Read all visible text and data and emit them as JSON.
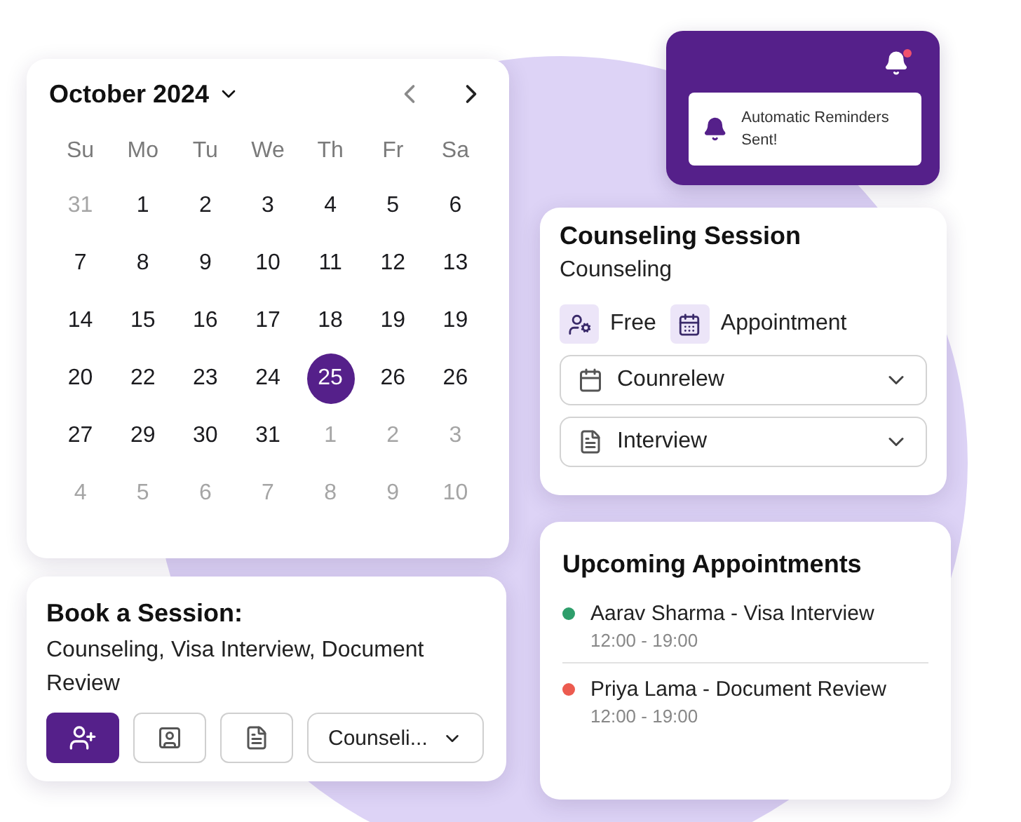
{
  "calendar": {
    "month": "October 2024",
    "weekdays": [
      "Su",
      "Mo",
      "Tu",
      "We",
      "Th",
      "Fr",
      "Sa"
    ],
    "weeks": [
      [
        {
          "day": "31",
          "outside": true,
          "selected": false
        },
        {
          "day": "1",
          "outside": false,
          "selected": false
        },
        {
          "day": "2",
          "outside": false,
          "selected": false
        },
        {
          "day": "3",
          "outside": false,
          "selected": false
        },
        {
          "day": "4",
          "outside": false,
          "selected": false
        },
        {
          "day": "5",
          "outside": false,
          "selected": false
        },
        {
          "day": "6",
          "outside": false,
          "selected": false
        }
      ],
      [
        {
          "day": "7",
          "outside": false,
          "selected": false
        },
        {
          "day": "8",
          "outside": false,
          "selected": false
        },
        {
          "day": "9",
          "outside": false,
          "selected": false
        },
        {
          "day": "10",
          "outside": false,
          "selected": false
        },
        {
          "day": "11",
          "outside": false,
          "selected": false
        },
        {
          "day": "12",
          "outside": false,
          "selected": false
        },
        {
          "day": "13",
          "outside": false,
          "selected": false
        }
      ],
      [
        {
          "day": "14",
          "outside": false,
          "selected": false
        },
        {
          "day": "15",
          "outside": false,
          "selected": false
        },
        {
          "day": "16",
          "outside": false,
          "selected": false
        },
        {
          "day": "17",
          "outside": false,
          "selected": false
        },
        {
          "day": "18",
          "outside": false,
          "selected": false
        },
        {
          "day": "19",
          "outside": false,
          "selected": false
        },
        {
          "day": "19",
          "outside": false,
          "selected": false
        }
      ],
      [
        {
          "day": "20",
          "outside": false,
          "selected": false
        },
        {
          "day": "22",
          "outside": false,
          "selected": false
        },
        {
          "day": "23",
          "outside": false,
          "selected": false
        },
        {
          "day": "24",
          "outside": false,
          "selected": false
        },
        {
          "day": "25",
          "outside": false,
          "selected": true
        },
        {
          "day": "26",
          "outside": false,
          "selected": false
        },
        {
          "day": "26",
          "outside": false,
          "selected": false
        }
      ],
      [
        {
          "day": "27",
          "outside": false,
          "selected": false
        },
        {
          "day": "29",
          "outside": false,
          "selected": false
        },
        {
          "day": "30",
          "outside": false,
          "selected": false
        },
        {
          "day": "31",
          "outside": false,
          "selected": false
        },
        {
          "day": "1",
          "outside": true,
          "selected": false
        },
        {
          "day": "2",
          "outside": true,
          "selected": false
        },
        {
          "day": "3",
          "outside": true,
          "selected": false
        }
      ],
      [
        {
          "day": "4",
          "outside": true,
          "selected": false
        },
        {
          "day": "5",
          "outside": true,
          "selected": false
        },
        {
          "day": "6",
          "outside": true,
          "selected": false
        },
        {
          "day": "7",
          "outside": true,
          "selected": false
        },
        {
          "day": "8",
          "outside": true,
          "selected": false
        },
        {
          "day": "9",
          "outside": true,
          "selected": false
        },
        {
          "day": "10",
          "outside": true,
          "selected": false
        }
      ]
    ]
  },
  "booking": {
    "title": "Book a Session:",
    "description": "Counseling, Visa Interview, Document Review",
    "actions": [
      {
        "kind": "add-person",
        "selected": true
      },
      {
        "kind": "video",
        "selected": false
      },
      {
        "kind": "document",
        "selected": false
      }
    ],
    "dropdown": "Counseli..."
  },
  "notification": {
    "unread": true,
    "message": "Automatic Reminders Sent!"
  },
  "session": {
    "title": "Counseling Session",
    "subtitle": "Counseling",
    "tags": [
      {
        "kind": "person",
        "label": "Free"
      },
      {
        "kind": "calendar",
        "label": "Appointment"
      }
    ],
    "selects": [
      {
        "kind": "calendar",
        "value": "Counrelew"
      },
      {
        "kind": "document",
        "value": "Interview"
      }
    ]
  },
  "upcoming": {
    "title": "Upcoming Appointments",
    "items": [
      {
        "name": "Aarav Sharma - Visa Interview",
        "time": "12:00 - 19:00",
        "color": "#2e9e6b"
      },
      {
        "name": "Priya Lama - Document Review",
        "time": "12:00 - 19:00",
        "color": "#ec5b4f"
      }
    ]
  }
}
